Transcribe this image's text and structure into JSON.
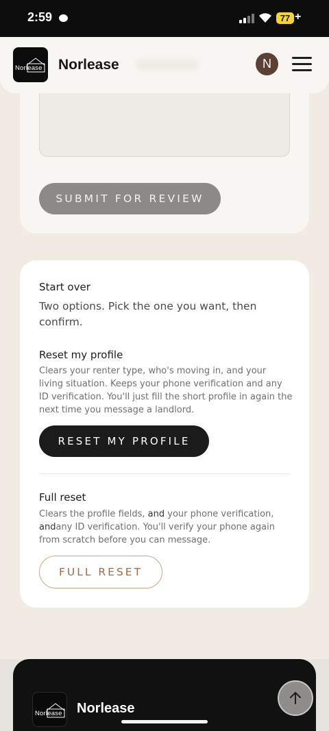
{
  "status_bar": {
    "time": "2:59",
    "battery": "77"
  },
  "header": {
    "brand": "Norlease",
    "logo_text": "Norlease",
    "avatar_initial": "N"
  },
  "review_card": {
    "submit_label": "SUBMIT FOR REVIEW"
  },
  "start_over": {
    "title": "Start over",
    "description": "Two options. Pick the one you want, then confirm.",
    "reset_profile": {
      "title": "Reset my profile",
      "description": "Clears your renter type, who's moving in, and your living situation. Keeps your phone verification and any ID verification. You'll just fill the short profile in again the next time you message a landlord.",
      "button_label": "RESET MY PROFILE"
    },
    "full_reset": {
      "title": "Full reset",
      "description_a": "Clears the profile fields, ",
      "description_and1": "and",
      "description_b": " your phone verification, ",
      "description_and2": "and",
      "description_c": "any ID verification. You'll verify your phone again from scratch before you can message.",
      "button_label": "FULL RESET"
    }
  },
  "footer": {
    "brand": "Norlease",
    "logo_text": "Norlease"
  },
  "icons": {
    "menu": "hamburger-icon",
    "scroll_top": "arrow-up-icon",
    "wifi": "wifi-icon",
    "signal": "signal-icon"
  },
  "colors": {
    "page_bg": "#f2ebe3",
    "accent": "#a06a43",
    "primary_button": "#1b1b1b",
    "disabled_button": "#8b8a88",
    "avatar": "#5e3f33"
  }
}
